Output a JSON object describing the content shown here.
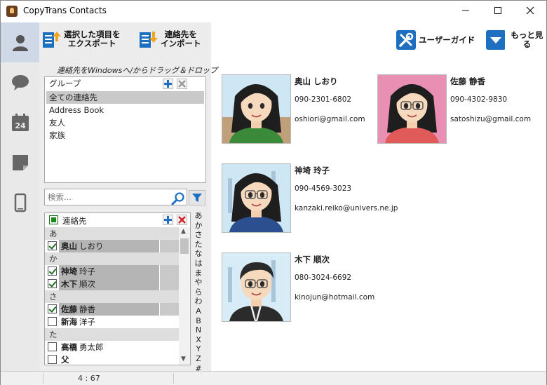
{
  "window": {
    "title": "CopyTrans Contacts"
  },
  "toolbar": {
    "export_line1": "選択した項目を",
    "export_line2": "エクスポート",
    "import_line1": "連絡先を",
    "import_line2": "インポート",
    "user_guide": "ユーザーガイド",
    "more": "もっと見る"
  },
  "drag_hint": "連絡先をWindowsへ/からドラッグ＆ドロップ",
  "groups": {
    "header": "グループ",
    "items": [
      "全ての連絡先",
      "Address Book",
      "友人",
      "家族"
    ],
    "selected_index": 0
  },
  "search": {
    "placeholder": "検索..."
  },
  "contact_list": {
    "header": "連絡先",
    "rows": [
      {
        "type": "section",
        "label": "あ"
      },
      {
        "type": "contact",
        "surname": "奥山",
        "given": "しおり",
        "checked": true,
        "selected": true
      },
      {
        "type": "section",
        "label": "か"
      },
      {
        "type": "contact",
        "surname": "神埼",
        "given": "玲子",
        "checked": true,
        "selected": true
      },
      {
        "type": "contact",
        "surname": "木下",
        "given": "順次",
        "checked": true,
        "selected": true
      },
      {
        "type": "section",
        "label": "さ"
      },
      {
        "type": "contact",
        "surname": "佐藤",
        "given": "静香",
        "checked": true,
        "selected": true
      },
      {
        "type": "contact",
        "surname": "新海",
        "given": "洋子",
        "checked": false,
        "selected": false
      },
      {
        "type": "section",
        "label": "た"
      },
      {
        "type": "contact",
        "surname": "高橋",
        "given": "勇太郎",
        "checked": false,
        "selected": false
      },
      {
        "type": "contact",
        "surname": "父",
        "given": "",
        "checked": false,
        "selected": false
      }
    ]
  },
  "alphabet_index": [
    "あ",
    "か",
    "さ",
    "た",
    "な",
    "は",
    "ま",
    "や",
    "ら",
    "わ",
    "A",
    "B",
    "N",
    "X",
    "Y",
    "Z",
    "#"
  ],
  "cards": [
    {
      "name": "奥山 しおり",
      "phone": "090-2301-6802",
      "email": "oshiori@gmail.com",
      "avatar": "female-avatar-1"
    },
    {
      "name": "佐藤 静香",
      "phone": "090-4302-9830",
      "email": "satoshizu@gmail.com",
      "avatar": "female-avatar-2"
    },
    {
      "name": "神埼 玲子",
      "phone": "090-4569-3023",
      "email": "kanzaki.reiko@univers.ne.jp",
      "avatar": "female-avatar-3"
    },
    {
      "name": "木下 順次",
      "phone": "080-3024-6692",
      "email": "kinojun@hotmail.com",
      "avatar": "male-avatar"
    }
  ],
  "status": {
    "count": "4 : 67"
  },
  "colors": {
    "accent_blue": "#1e6fc0",
    "selected_row": "#b5b5b5",
    "nav_active": "#cfd8e6"
  }
}
